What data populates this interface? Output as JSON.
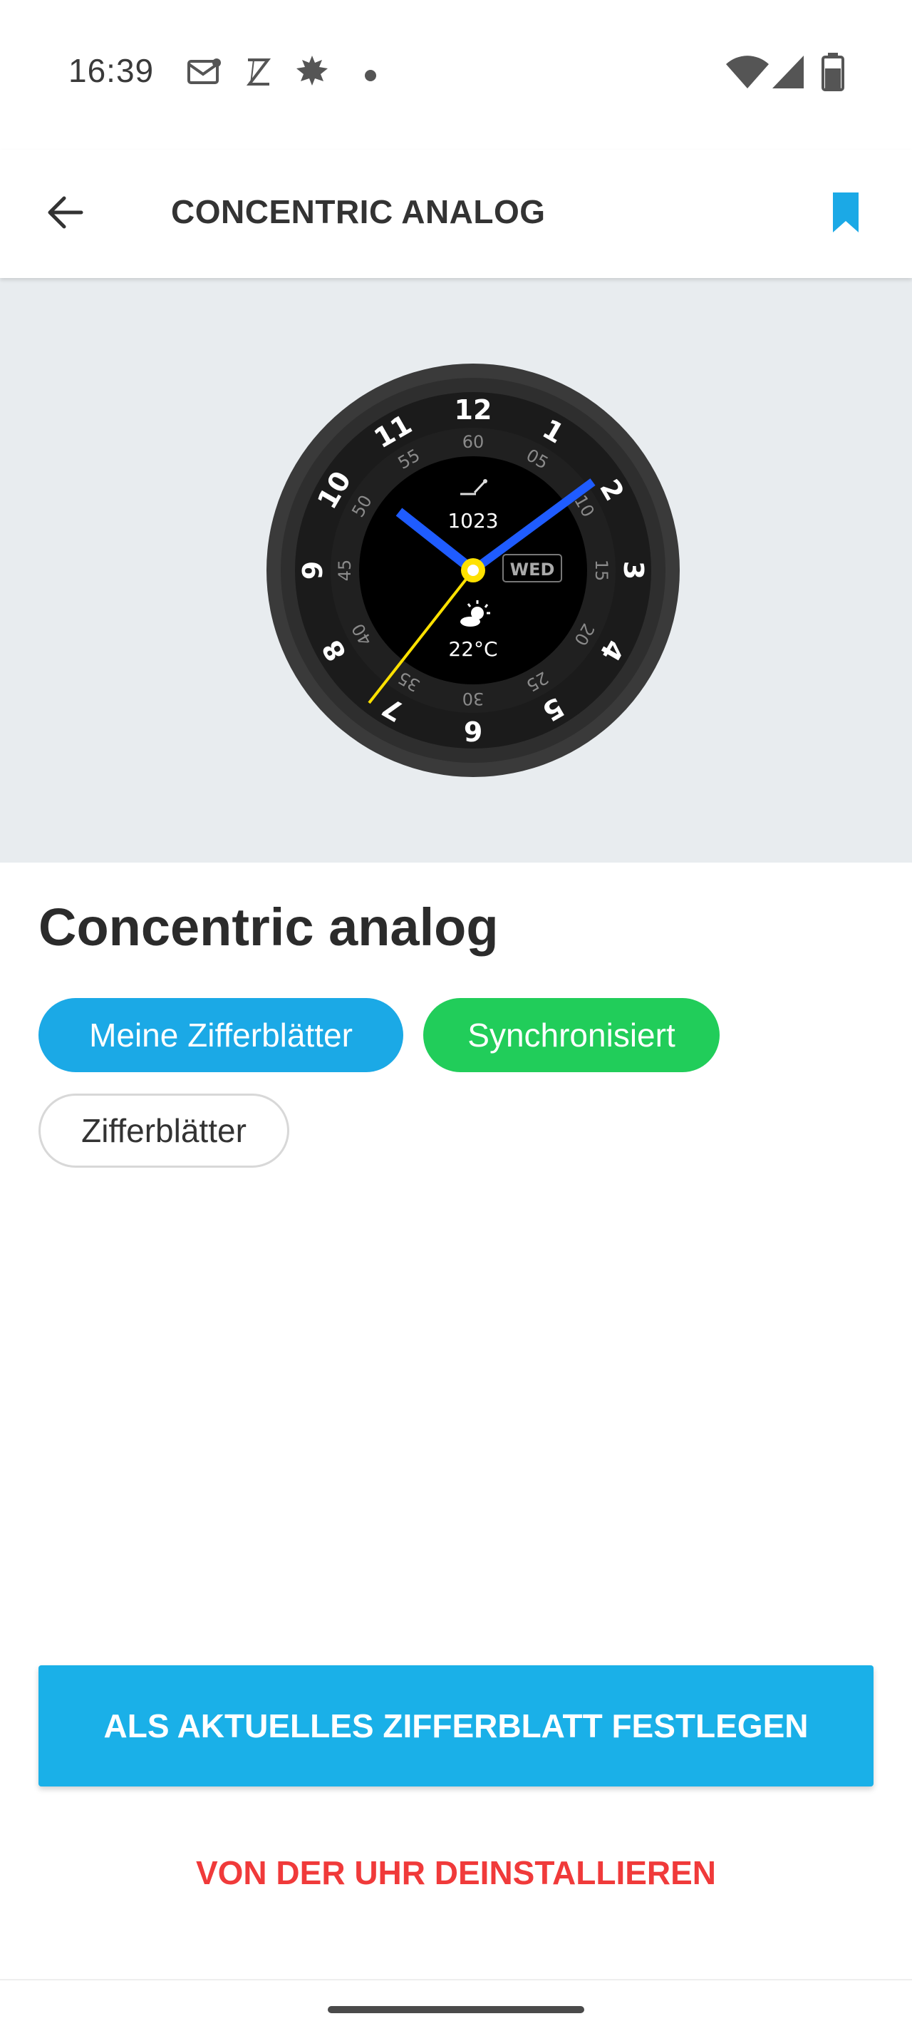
{
  "status_bar": {
    "time": "16:39",
    "icons": [
      "mail-icon",
      "z-app-icon",
      "leaf-icon",
      "dot-icon",
      "wifi-icon",
      "signal-icon",
      "battery-icon"
    ]
  },
  "app_bar": {
    "title": "CONCENTRIC ANALOG",
    "icons": [
      "back-arrow-icon",
      "bookmark-icon"
    ],
    "accent_color": "#1ba9e6"
  },
  "watch_face": {
    "hours": [
      "12",
      "1",
      "2",
      "3",
      "4",
      "5",
      "6",
      "7",
      "8",
      "9",
      "10",
      "11"
    ],
    "minutes": [
      "60",
      "05",
      "10",
      "15",
      "20",
      "25",
      "30",
      "35",
      "40",
      "45",
      "50",
      "55"
    ],
    "pressure": "1023",
    "day": "WED",
    "temperature": "22°C",
    "icons": [
      "barometer-icon",
      "weather-partly-sunny-icon"
    ],
    "hand_color": "#1f5cff",
    "second_hand_color": "#ffe100"
  },
  "details": {
    "name": "Concentric analog",
    "tags": [
      {
        "label": "Meine Zifferblätter",
        "color": "#1ba9e6"
      },
      {
        "label": "Synchronisiert",
        "color": "#21cd5a"
      },
      {
        "label": "Zifferblätter",
        "color": "#ffffff"
      }
    ]
  },
  "actions": {
    "primary_label": "ALS AKTUELLES ZIFFERBLATT FESTLEGEN",
    "danger_label": "VON DER UHR DEINSTALLIEREN",
    "danger_color": "#f03a3a"
  }
}
